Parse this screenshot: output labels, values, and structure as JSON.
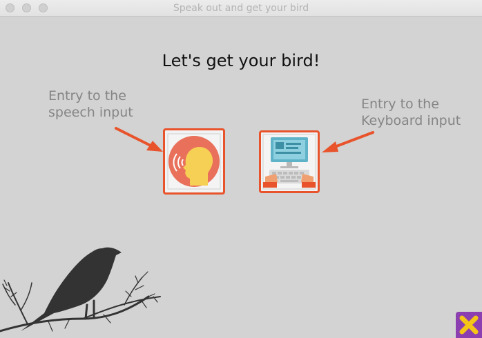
{
  "window": {
    "title": "Speak out and get your bird",
    "controls": [
      "close",
      "minimize",
      "zoom"
    ]
  },
  "main": {
    "heading": "Let's get your bird!",
    "speech_note": "Entry to the\nspeech input",
    "keyboard_note": "Entry to the\nKeyboard input"
  },
  "buttons": {
    "speech": {
      "icon": "speaking-head-icon"
    },
    "keyboard": {
      "icon": "computer-keyboard-icon"
    },
    "close": {
      "icon": "close-x-icon"
    }
  },
  "colors": {
    "background": "#d3d3d3",
    "accent": "#e8532b",
    "close_button": "#8b3fb0",
    "close_glyph": "#f5c518",
    "bird": "#333333"
  }
}
